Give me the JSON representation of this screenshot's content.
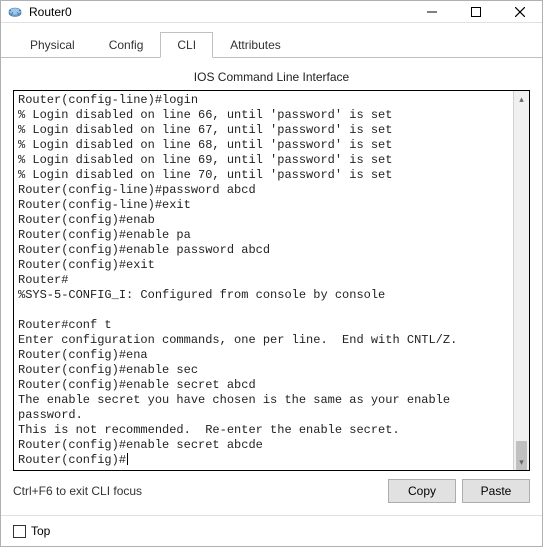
{
  "window": {
    "title": "Router0"
  },
  "tabs": {
    "physical": "Physical",
    "config": "Config",
    "cli": "CLI",
    "attributes": "Attributes"
  },
  "panel": {
    "title": "IOS Command Line Interface"
  },
  "terminal": {
    "lines": [
      "Router(config-line)#login",
      "% Login disabled on line 66, until 'password' is set",
      "% Login disabled on line 67, until 'password' is set",
      "% Login disabled on line 68, until 'password' is set",
      "% Login disabled on line 69, until 'password' is set",
      "% Login disabled on line 70, until 'password' is set",
      "Router(config-line)#password abcd",
      "Router(config-line)#exit",
      "Router(config)#enab",
      "Router(config)#enable pa",
      "Router(config)#enable password abcd",
      "Router(config)#exit",
      "Router#",
      "%SYS-5-CONFIG_I: Configured from console by console",
      "",
      "Router#conf t",
      "Enter configuration commands, one per line.  End with CNTL/Z.",
      "Router(config)#ena",
      "Router(config)#enable sec",
      "Router(config)#enable secret abcd",
      "The enable secret you have chosen is the same as your enable",
      "password.",
      "This is not recommended.  Re-enter the enable secret.",
      "Router(config)#enable secret abcde",
      "Router(config)#"
    ]
  },
  "buttons": {
    "hint": "Ctrl+F6 to exit CLI focus",
    "copy": "Copy",
    "paste": "Paste"
  },
  "bottom": {
    "top_label": "Top"
  }
}
